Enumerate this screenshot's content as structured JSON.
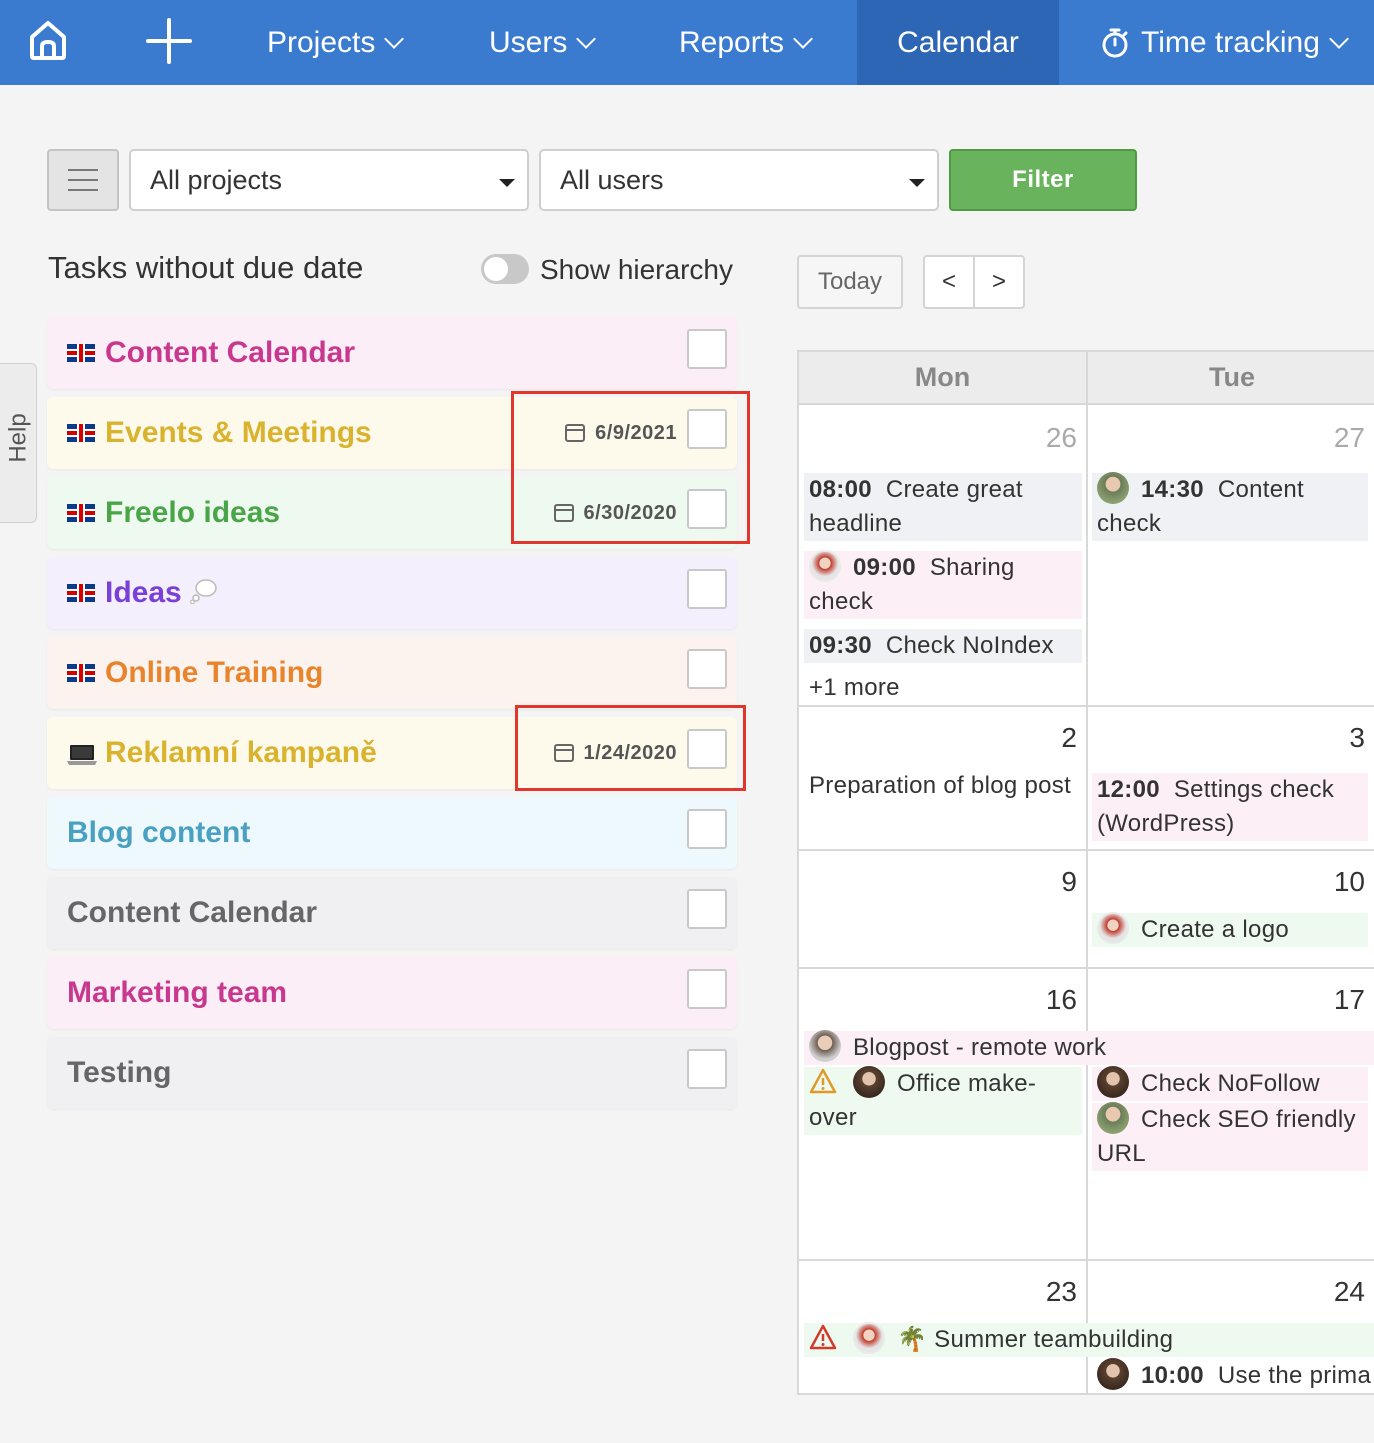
{
  "nav": {
    "items": [
      {
        "label": "Projects"
      },
      {
        "label": "Users"
      },
      {
        "label": "Reports"
      },
      {
        "label": "Calendar"
      },
      {
        "label": "Time tracking"
      }
    ],
    "active": "Calendar"
  },
  "toolbar": {
    "project_select": "All projects",
    "user_select": "All users",
    "filter_label": "Filter"
  },
  "sidebar": {
    "help_label": "Help",
    "title": "Tasks without due date",
    "hierarchy_label": "Show hierarchy",
    "projects": [
      {
        "name": "Content Calendar",
        "icon": "uk-flag-icon",
        "color": "#c9388f",
        "bg": "#fbeef6",
        "due": ""
      },
      {
        "name": "Events & Meetings",
        "icon": "uk-flag-icon",
        "color": "#d9b22e",
        "bg": "#fdfaec",
        "due": "6/9/2021"
      },
      {
        "name": "Freelo ideas",
        "icon": "uk-flag-icon",
        "color": "#4aa548",
        "bg": "#eef9ef",
        "due": "6/30/2020"
      },
      {
        "name": "Ideas",
        "icon": "uk-flag-icon",
        "color": "#7a3fd6",
        "bg": "#f4effd",
        "due": "",
        "suffix_icon": "thought-bubble-icon"
      },
      {
        "name": "Online Training",
        "icon": "uk-flag-icon",
        "color": "#e8842c",
        "bg": "#fdf3ee",
        "due": ""
      },
      {
        "name": "Reklamní kampaně",
        "icon": "laptop-icon",
        "color": "#d9b22e",
        "bg": "#fdfaec",
        "due": "1/24/2020"
      },
      {
        "name": "Blog content",
        "icon": "",
        "color": "#4aa0c0",
        "bg": "#eef9fd",
        "due": ""
      },
      {
        "name": "Content Calendar",
        "icon": "",
        "color": "#666666",
        "bg": "#f0f0f2",
        "due": ""
      },
      {
        "name": "Marketing team",
        "icon": "",
        "color": "#c9388f",
        "bg": "#fbeef6",
        "due": ""
      },
      {
        "name": "Testing",
        "icon": "",
        "color": "#666666",
        "bg": "#f0f0f2",
        "due": ""
      }
    ]
  },
  "calendar": {
    "today_label": "Today",
    "prev_label": "<",
    "next_label": ">",
    "days": [
      "Mon",
      "Tue"
    ],
    "weeks": [
      {
        "mon": {
          "date": "26",
          "events": [
            {
              "time": "08:00",
              "title": "Create great headline"
            },
            {
              "time": "09:00",
              "title": "Sharing check",
              "avatar": "avatar-b"
            },
            {
              "time": "09:30",
              "title": "Check NoIndex"
            }
          ],
          "more": "+1 more"
        },
        "tue": {
          "date": "27",
          "events": [
            {
              "time": "14:30",
              "title": "Content check",
              "avatar": "avatar-a"
            }
          ]
        }
      },
      {
        "mon": {
          "date": "2",
          "events": [
            {
              "time": "",
              "title": "Preparation of blog post"
            }
          ]
        },
        "tue": {
          "date": "3",
          "events": [
            {
              "time": "12:00",
              "title": "Settings check (WordPress)"
            }
          ]
        }
      },
      {
        "mon": {
          "date": "9",
          "events": []
        },
        "tue": {
          "date": "10",
          "events": [
            {
              "time": "",
              "title": "Create a logo",
              "avatar": "avatar-b"
            }
          ]
        }
      },
      {
        "mon": {
          "date": "16",
          "events": [
            {
              "time": "",
              "title": "Blogpost - remote work",
              "avatar": "avatar-d"
            },
            {
              "time": "",
              "title": "Office make-over",
              "avatar": "avatar-c",
              "warning": true
            }
          ]
        },
        "tue": {
          "date": "17",
          "events": [
            {
              "time": "",
              "title": "Check NoFollow",
              "avatar": "avatar-c"
            },
            {
              "time": "",
              "title": "Check SEO friendly URL",
              "avatar": "avatar-a"
            }
          ]
        }
      },
      {
        "mon": {
          "date": "23",
          "events": [
            {
              "time": "",
              "title": "🌴 Summer teambuilding",
              "avatar": "avatar-b",
              "warning": true
            }
          ]
        },
        "tue": {
          "date": "24",
          "events": [
            {
              "time": "10:00",
              "title": "Use the prima",
              "avatar": "avatar-c"
            }
          ]
        }
      }
    ]
  }
}
